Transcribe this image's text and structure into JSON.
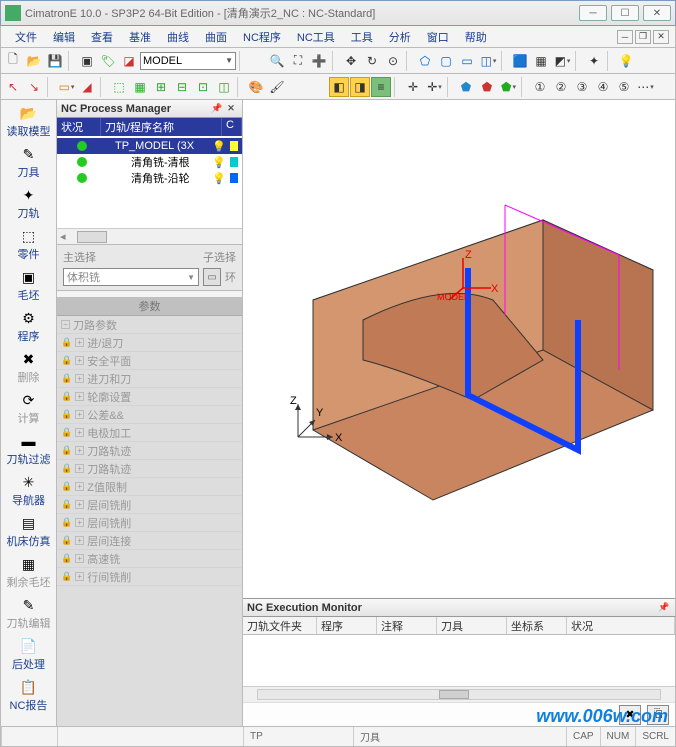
{
  "title": "CimatronE 10.0 - SP3P2 64-Bit Edition - [清角演示2_NC : NC-Standard]",
  "menu": [
    "文件",
    "编辑",
    "查看",
    "基准",
    "曲线",
    "曲面",
    "NC程序",
    "NC工具",
    "工具",
    "分析",
    "窗口",
    "帮助"
  ],
  "model_combo": "MODEL",
  "left_tools": [
    {
      "label": "读取模型",
      "gray": false,
      "icon": "📂"
    },
    {
      "label": "刀具",
      "gray": false,
      "icon": "✎"
    },
    {
      "label": "刀轨",
      "gray": false,
      "icon": "✦"
    },
    {
      "label": "零件",
      "gray": false,
      "icon": "⬚"
    },
    {
      "label": "毛坯",
      "gray": false,
      "icon": "▣"
    },
    {
      "label": "程序",
      "gray": false,
      "icon": "⚙"
    },
    {
      "label": "删除",
      "gray": true,
      "icon": "✖"
    },
    {
      "label": "计算",
      "gray": true,
      "icon": "⟳"
    },
    {
      "label": "刀轨过滤",
      "gray": false,
      "icon": "▬"
    },
    {
      "label": "导航器",
      "gray": false,
      "icon": "✳"
    },
    {
      "label": "机床仿真",
      "gray": false,
      "icon": "▤"
    },
    {
      "label": "剩余毛坯",
      "gray": true,
      "icon": "▦"
    },
    {
      "label": "刀轨编辑",
      "gray": true,
      "icon": "✎"
    },
    {
      "label": "后处理",
      "gray": false,
      "icon": "📄"
    },
    {
      "label": "NC报告",
      "gray": false,
      "icon": "📋"
    }
  ],
  "proc_manager": {
    "title": "NC Process Manager",
    "columns": {
      "c1": "状况",
      "c2": "刀轨/程序名称",
      "c3": "C"
    },
    "rows": [
      {
        "name": "TP_MODEL (3X",
        "selected": true,
        "chip": "#ff3"
      },
      {
        "name": "清角铣-清根",
        "selected": false,
        "chip": "#0cc"
      },
      {
        "name": "清角铣-沿轮",
        "selected": false,
        "chip": "#06f"
      }
    ]
  },
  "select_panel": {
    "main_label": "主选择",
    "sub_label": "子选择",
    "combo": "体积铣",
    "ring": "环"
  },
  "params": {
    "header": "参数",
    "rows": [
      "刀路参数",
      "进/退刀",
      "安全平面",
      "进刀和刀",
      "轮廓设置",
      "公差&&",
      "电极加工",
      "刀路轨迹",
      "刀路轨迹",
      "Z值限制",
      "层间铣削",
      "层间铣削",
      "层间连接",
      "高速铣",
      "行间铣削"
    ]
  },
  "exec_monitor": {
    "title": "NC Execution Monitor",
    "columns": [
      "刀轨文件夹",
      "程序",
      "注释",
      "刀具",
      "坐标系",
      "状况"
    ]
  },
  "status": {
    "tp": "TP",
    "tool": "刀具",
    "caps": [
      "CAP",
      "NUM",
      "SCRL"
    ]
  },
  "axis": {
    "x": "X",
    "y": "Y",
    "z": "Z",
    "model": "MODEL"
  },
  "watermark": "www.006w.com"
}
